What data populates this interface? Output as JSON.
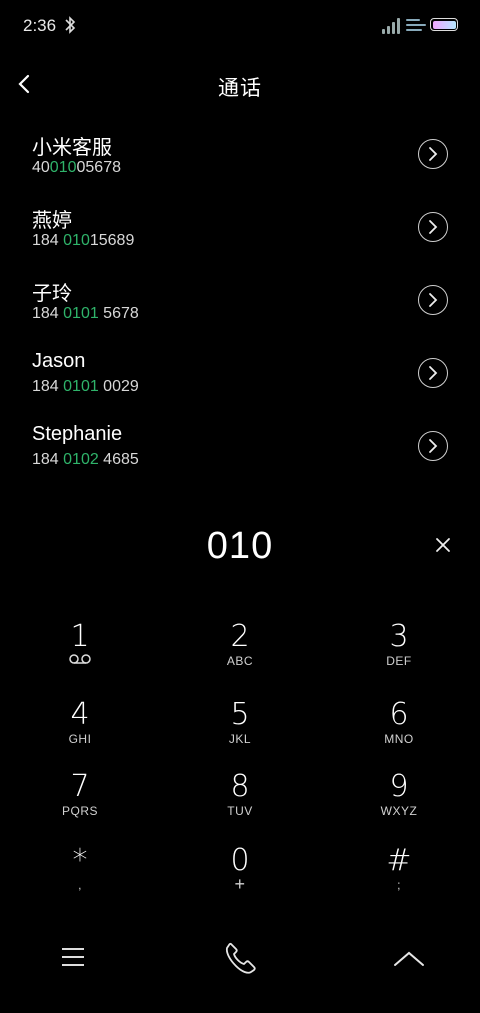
{
  "status": {
    "time": "2:36"
  },
  "header": {
    "title": "通话"
  },
  "contacts": [
    {
      "name": "小米客服",
      "num_pre": "40",
      "num_hl": "010",
      "num_post": "05678"
    },
    {
      "name": "燕婷",
      "num_pre": "184 ",
      "num_hl": "010",
      "num_post": "15689"
    },
    {
      "name": "子玲",
      "num_pre": "184 ",
      "num_hl": "0101",
      "num_post": " 5678"
    },
    {
      "name": "Jason",
      "num_pre": "184 ",
      "num_hl": "0101",
      "num_post": " 0029"
    },
    {
      "name": "Stephanie",
      "num_pre": "184 ",
      "num_hl": "0102",
      "num_post": " 4685"
    }
  ],
  "dialer": {
    "input": "010"
  },
  "keys": [
    {
      "digit": "1",
      "letters": ""
    },
    {
      "digit": "2",
      "letters": "ABC"
    },
    {
      "digit": "3",
      "letters": "DEF"
    },
    {
      "digit": "4",
      "letters": "GHI"
    },
    {
      "digit": "5",
      "letters": "JKL"
    },
    {
      "digit": "6",
      "letters": "MNO"
    },
    {
      "digit": "7",
      "letters": "PQRS"
    },
    {
      "digit": "8",
      "letters": "TUV"
    },
    {
      "digit": "9",
      "letters": "WXYZ"
    },
    {
      "digit": "*",
      "letters": ","
    },
    {
      "digit": "0",
      "letters": "+"
    },
    {
      "digit": "#",
      "letters": ";"
    }
  ],
  "icons": {
    "back": "chevron-left-icon",
    "clear": "close-icon",
    "menu": "menu-icon",
    "call": "phone-icon",
    "collapse": "chevron-up-icon",
    "voicemail": "voicemail-icon"
  },
  "colors": {
    "match_highlight": "#2fb36a",
    "background": "#000000"
  }
}
